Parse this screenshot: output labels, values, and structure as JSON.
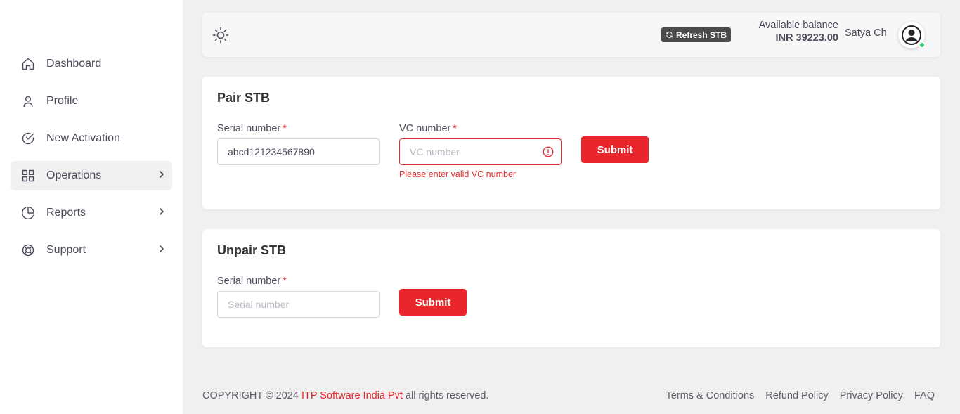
{
  "sidebar": {
    "items": [
      {
        "label": "Dashboard",
        "icon": "home-icon",
        "active": false,
        "has_children": false
      },
      {
        "label": "Profile",
        "icon": "user-icon",
        "active": false,
        "has_children": false
      },
      {
        "label": "New Activation",
        "icon": "check-circle-icon",
        "active": false,
        "has_children": false
      },
      {
        "label": "Operations",
        "icon": "grid-icon",
        "active": true,
        "has_children": true
      },
      {
        "label": "Reports",
        "icon": "pie-chart-icon",
        "active": false,
        "has_children": true
      },
      {
        "label": "Support",
        "icon": "lifebuoy-icon",
        "active": false,
        "has_children": true
      }
    ]
  },
  "header": {
    "theme_icon": "sun-icon",
    "refresh_label": "Refresh STB",
    "balance_label": "Available balance",
    "balance_value": "INR 39223.00",
    "username": "Satya Ch",
    "avatar_icon": "user-circle-icon",
    "status_color": "#28c76f"
  },
  "pair": {
    "title": "Pair STB",
    "serial_label": "Serial number",
    "required_mark": "*",
    "serial_value": "abcd121234567890",
    "vc_label": "VC number",
    "vc_placeholder": "VC number",
    "vc_value": "",
    "vc_error": "Please enter valid VC number",
    "submit_label": "Submit"
  },
  "unpair": {
    "title": "Unpair STB",
    "serial_label": "Serial number",
    "required_mark": "*",
    "serial_placeholder": "Serial number",
    "serial_value": "",
    "submit_label": "Submit"
  },
  "footer": {
    "copyright_prefix": "COPYRIGHT © 2024 ",
    "company": "ITP Software India Pvt",
    "copyright_suffix": " all rights reserved.",
    "links": [
      "Terms & Conditions",
      "Refund Policy",
      "Privacy Policy",
      "FAQ"
    ]
  },
  "colors": {
    "accent": "#e8262b",
    "error": "#ea2c2c",
    "sidebar_active_bg": "#f1f1f1",
    "page_bg": "#f0f0f0"
  }
}
